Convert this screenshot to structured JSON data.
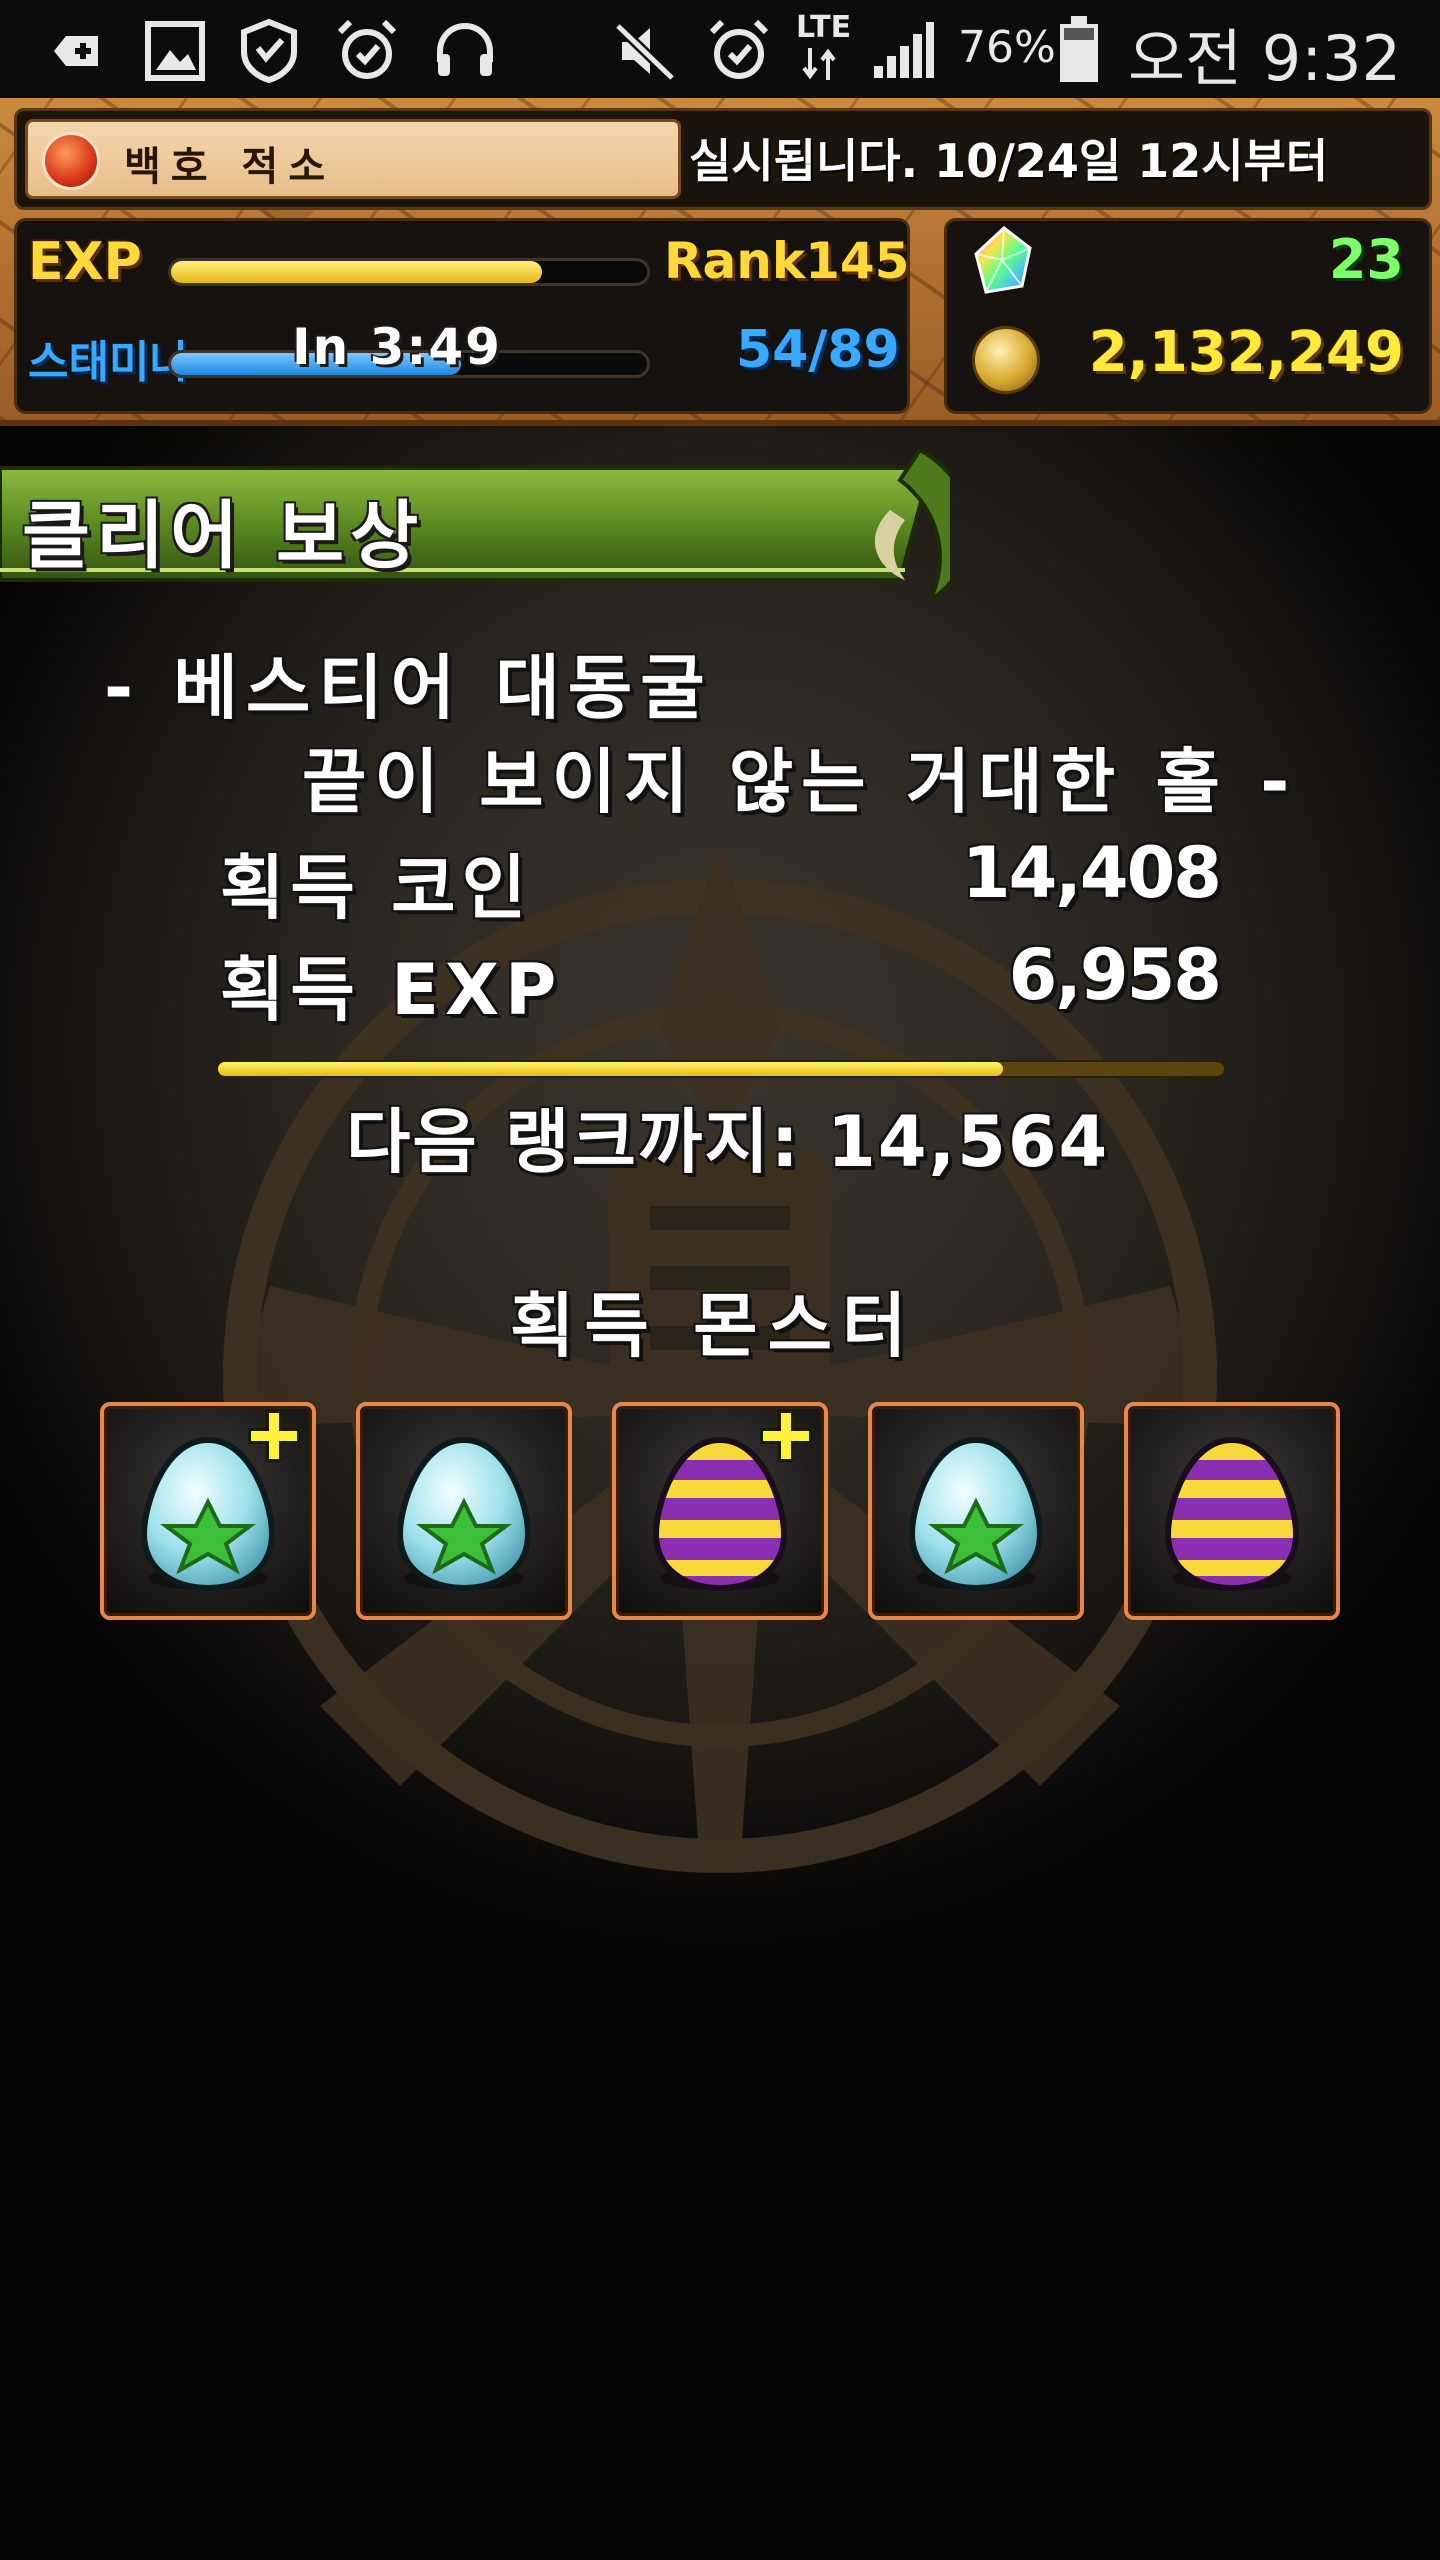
{
  "status_bar": {
    "battery": "76%",
    "time": "오전 9:32",
    "network": "LTE",
    "icons": [
      "add-icon",
      "image-icon",
      "shield-hand-icon",
      "alarm-icon",
      "headphones-icon",
      "mute-icon",
      "alarm-icon",
      "signal-icon",
      "battery-icon"
    ]
  },
  "header": {
    "news_tab": "백호 적소",
    "news_ticker": "실시됩니다. 10/24일 12시부터",
    "exp_label": "EXP",
    "exp_progress": 0.78,
    "rank": "Rank145",
    "stamina_label": "스태미나",
    "stamina_timer": "In 3:49",
    "stamina_value": "54/89",
    "stamina_progress": 0.61,
    "magic_stones": "23",
    "coins": "2,132,249"
  },
  "result": {
    "title": "클리어 보상",
    "dungeon_line1": "- 베스티어 대동굴",
    "dungeon_line2": "끝이 보이지 않는 거대한 홀 -",
    "coin_label": "획득 코인",
    "coin_value": "14,408",
    "exp_label": "획득 EXP",
    "exp_value": "6,958",
    "rank_progress": 0.78,
    "next_rank": "다음 랭크까지: 14,564",
    "monster_title": "획득 몬스터"
  },
  "monsters": [
    {
      "egg": "star-egg",
      "plus": true
    },
    {
      "egg": "star-egg",
      "plus": false
    },
    {
      "egg": "striped-egg",
      "plus": true
    },
    {
      "egg": "star-egg",
      "plus": false
    },
    {
      "egg": "striped-egg",
      "plus": false
    }
  ],
  "colors": {
    "exp_bar": "#f2cf2a",
    "stamina_bar": "#2f9dff",
    "stone_count": "#7dff6a",
    "coin_count": "#ffe93a",
    "banner_green": "#5b8a22",
    "slot_border": "#e8874a"
  }
}
